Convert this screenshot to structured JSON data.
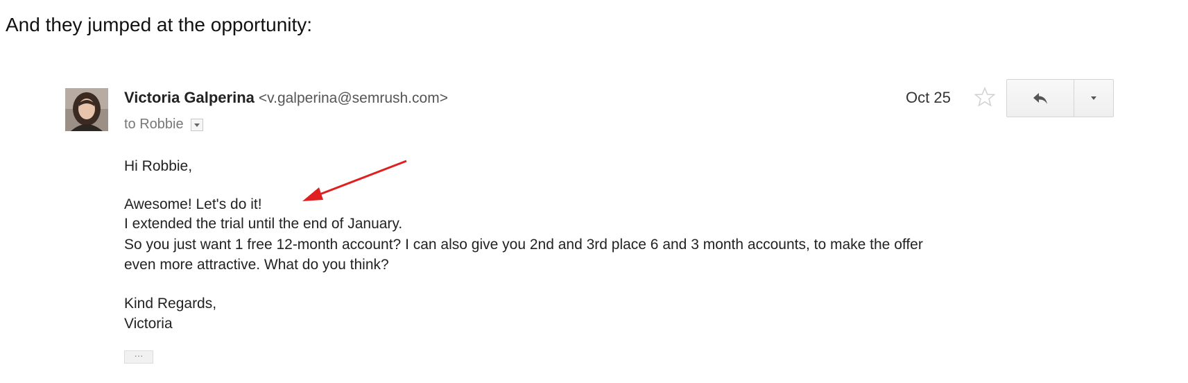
{
  "intro_text": "And they jumped at the opportunity:",
  "email": {
    "sender": {
      "name": "Victoria Galperina",
      "email": "<v.galperina@semrush.com>"
    },
    "recipient_line": "to Robbie",
    "date": "Oct 25",
    "body": {
      "greeting": "Hi Robbie,",
      "lines": [
        "Awesome! Let's do it!",
        "I extended the trial until the end of January.",
        "So you just want 1 free 12-month account? I can also give you 2nd and 3rd place 6 and 3 month accounts, to make the offer",
        "even more attractive. What do you think?"
      ],
      "closing": "Kind Regards,",
      "signature": "Victoria"
    },
    "trimmed_content_label": "···"
  },
  "icons": {
    "star": "star-outline-icon",
    "reply": "reply-arrow-icon",
    "more": "chevron-down-icon",
    "annotation": "red-arrow-annotation"
  },
  "colors": {
    "annotation_arrow": "#e02020",
    "button_border": "#d4d4d4",
    "muted_text": "#777777"
  }
}
